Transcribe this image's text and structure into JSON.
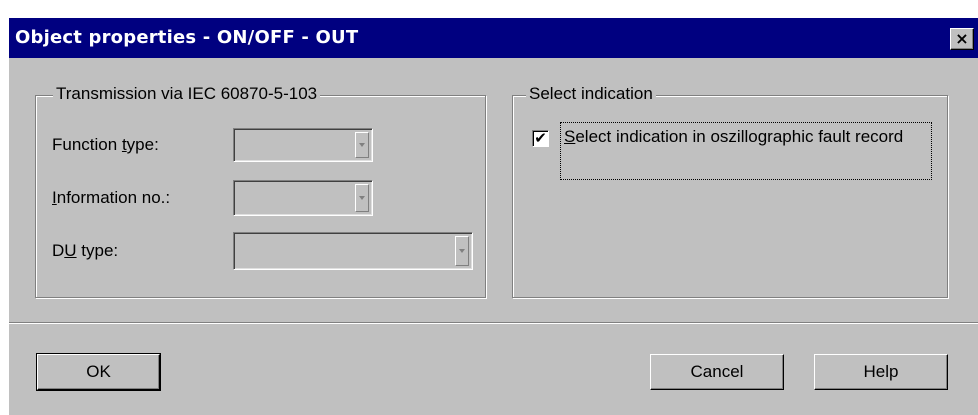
{
  "window": {
    "title": "Object properties - ON/OFF - OUT",
    "close_symbol": "×"
  },
  "transmission_group": {
    "legend": "Transmission via IEC 60870-5-103",
    "fields": [
      {
        "label_prefix": "Function ",
        "label_mnemonic": "t",
        "label_suffix": "ype:",
        "value": ""
      },
      {
        "label_prefix": "",
        "label_mnemonic": "I",
        "label_suffix": "nformation no.:",
        "value": ""
      },
      {
        "label_prefix": "D",
        "label_mnemonic": "U",
        "label_suffix": " type:",
        "value": ""
      }
    ]
  },
  "select_group": {
    "legend": "Select indication",
    "checkbox": {
      "checked": true,
      "check_mark": "✔",
      "label_mnemonic": "S",
      "label_rest": "elect indication in oszillographic fault record"
    }
  },
  "buttons": {
    "ok": "OK",
    "cancel": "Cancel",
    "help": "Help"
  },
  "icons": {
    "close": "close-icon",
    "dropdown": "chevron-down-icon",
    "check": "checkmark-icon"
  }
}
